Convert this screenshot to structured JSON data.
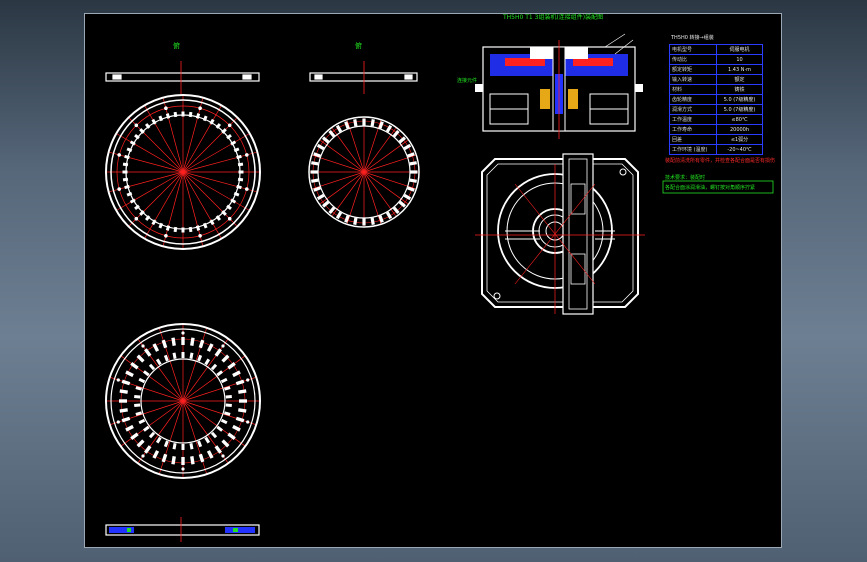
{
  "drawing": {
    "colors": {
      "background": "#000000",
      "outline": "#ffffff",
      "centerline": "#ff2020",
      "accent": "#2233ff",
      "label": "#22e322",
      "note": "#ff2a2a"
    },
    "view_a_label": "俯",
    "view_b_label": "俯",
    "assembly_title": "TH5H0 T1 3组装机(连接组件)装配图",
    "part_label": "连接元件",
    "table_header": "TH5H0 转接→组装",
    "table_rows": [
      {
        "k": "电机型号",
        "v": "伺服电机"
      },
      {
        "k": "传动比",
        "v": "10"
      },
      {
        "k": "额定转矩",
        "v": "1.43 N·m"
      },
      {
        "k": "输入转速",
        "v": "额定"
      },
      {
        "k": "材料",
        "v": "铸铁"
      },
      {
        "k": "齿轮精度",
        "v": "5.0 (7级精度)"
      },
      {
        "k": "润滑方式",
        "v": "5.0 (7级精度)"
      },
      {
        "k": "工作温度",
        "v": "≤80℃"
      },
      {
        "k": "工作寿命",
        "v": "20000h"
      },
      {
        "k": "回差",
        "v": "≤1弧分"
      },
      {
        "k": "工作环境 (温度)",
        "v": "-20~40℃"
      }
    ],
    "red_note": "装配前清洗所有零件，并检查各配合面是否有损伤",
    "green_note_1": "技术要求：装配时",
    "green_note_2": "各配合面涂润滑油，螺钉按对角顺序拧紧"
  }
}
